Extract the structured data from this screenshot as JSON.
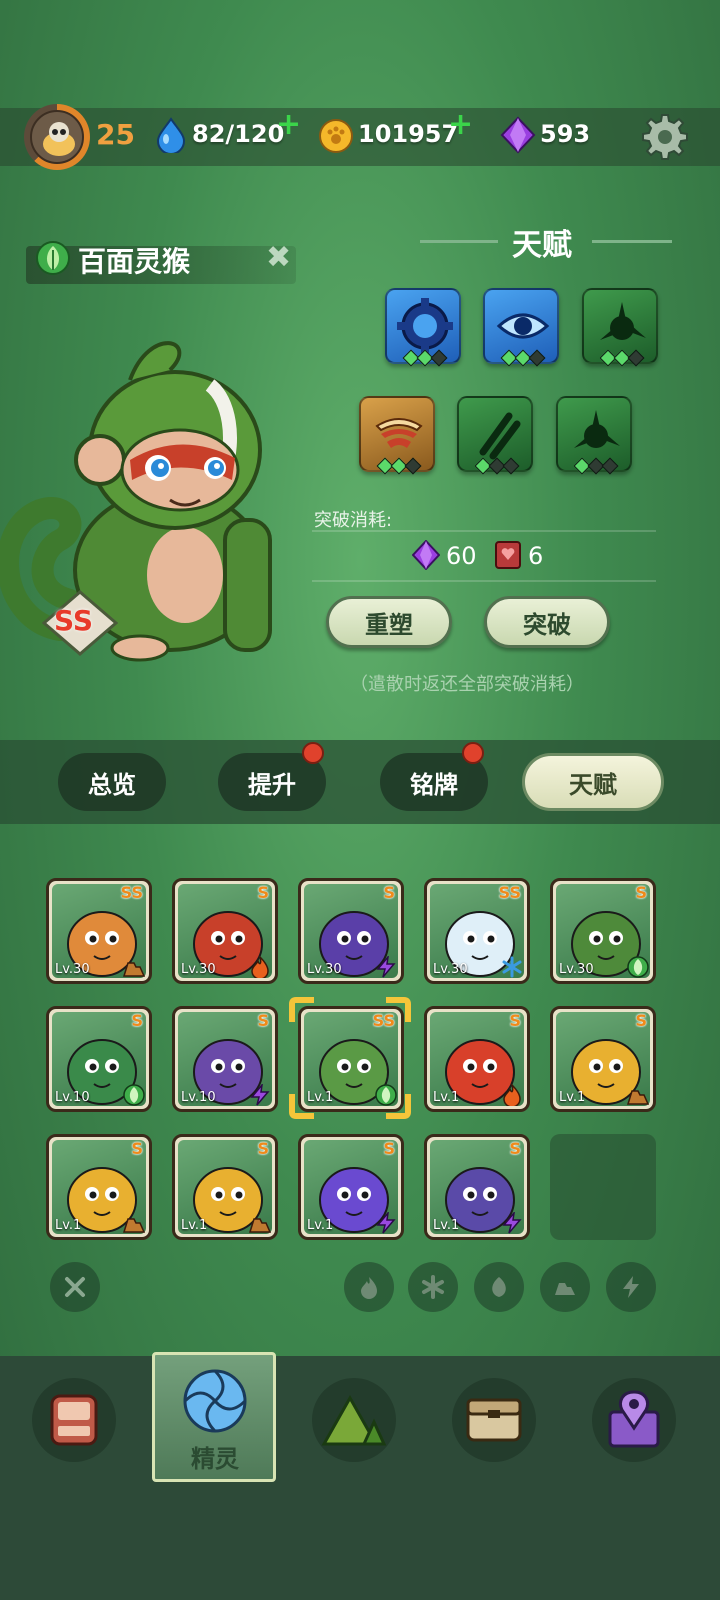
{
  "player": {
    "level": "25"
  },
  "resources": {
    "water": "82/120",
    "coins": "101957",
    "gems": "593",
    "plus": "+"
  },
  "spirit": {
    "name": "百面灵猴",
    "rank": "SS"
  },
  "talent": {
    "title": "天赋",
    "breakthrough_cost_label": "突破消耗:",
    "cost_gems": "60",
    "cost_books": "6",
    "reshape_label": "重塑",
    "breakthrough_label": "突破",
    "note": "（遣散时返还全部突破消耗）",
    "icons": [
      {
        "icon": "gear-ring-icon",
        "color": "blue",
        "level": 2
      },
      {
        "icon": "eye-icon",
        "color": "blue",
        "level": 2
      },
      {
        "icon": "thorn-icon",
        "color": "green",
        "level": 2
      },
      {
        "icon": "feather-wing-icon",
        "color": "gold",
        "level": 2
      },
      {
        "icon": "claw-slash-icon",
        "color": "green",
        "level": 1
      },
      {
        "icon": "thorn-icon",
        "color": "green",
        "level": 1
      }
    ]
  },
  "tabs": {
    "overview": "总览",
    "upgrade": "提升",
    "badge": "铭牌",
    "talent": "天赋"
  },
  "roster": [
    {
      "name": "phoenix",
      "rank": "SS",
      "level": "Lv.30",
      "element": "earth",
      "color": "#e08a3a"
    },
    {
      "name": "red-dragon",
      "rank": "S",
      "level": "Lv.30",
      "element": "fire",
      "color": "#c8402a"
    },
    {
      "name": "dark-cat",
      "rank": "S",
      "level": "Lv.30",
      "element": "thunder",
      "color": "#5a3fa8"
    },
    {
      "name": "ice-dragon",
      "rank": "SS",
      "level": "Lv.30",
      "element": "ice",
      "color": "#dfeff8"
    },
    {
      "name": "green-monkey",
      "rank": "S",
      "level": "Lv.30",
      "element": "grass",
      "color": "#4e8a3a"
    },
    {
      "name": "green-snake",
      "rank": "S",
      "level": "Lv.10",
      "element": "grass",
      "color": "#3a8a4a"
    },
    {
      "name": "purple-unicorn",
      "rank": "S",
      "level": "Lv.10",
      "element": "thunder",
      "color": "#6a4aa8"
    },
    {
      "name": "green-monkey-selected",
      "rank": "SS",
      "level": "Lv.1",
      "element": "grass",
      "color": "#5a9a45"
    },
    {
      "name": "red-horn-blob",
      "rank": "S",
      "level": "Lv.1",
      "element": "fire",
      "color": "#d8402a"
    },
    {
      "name": "sunflower",
      "rank": "S",
      "level": "Lv.1",
      "element": "earth",
      "color": "#e8b030"
    },
    {
      "name": "sunflower",
      "rank": "S",
      "level": "Lv.1",
      "element": "earth",
      "color": "#e8b030"
    },
    {
      "name": "sunflower",
      "rank": "S",
      "level": "Lv.1",
      "element": "earth",
      "color": "#e8b030"
    },
    {
      "name": "purple-imp",
      "rank": "S",
      "level": "Lv.1",
      "element": "thunder",
      "color": "#6a4ad0"
    },
    {
      "name": "purple-croc",
      "rank": "S",
      "level": "Lv.1",
      "element": "thunder",
      "color": "#5a4aa8"
    }
  ],
  "nav": {
    "spirit_label": "精灵"
  },
  "colors": {
    "accent_orange": "#f08a1a",
    "fire": "#e8601e",
    "grass": "#3fae4a",
    "thunder": "#9a4ae0",
    "ice": "#3a9ae0",
    "earth": "#c07a30"
  }
}
